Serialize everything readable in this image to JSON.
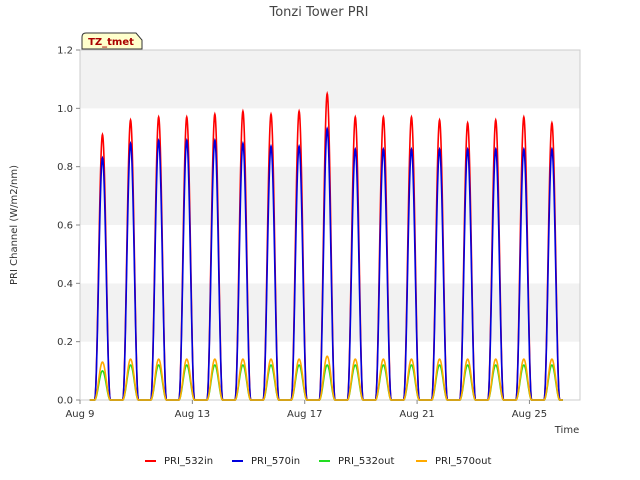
{
  "chart_data": {
    "type": "line",
    "title": "Tonzi Tower PRI",
    "xlabel": "Time",
    "ylabel": "PRI Channel (W/m2/nm)",
    "ylim": [
      0.0,
      1.2
    ],
    "yticks": [
      "0.0",
      "0.2",
      "0.4",
      "0.6",
      "0.8",
      "1.0",
      "1.2"
    ],
    "xlim_days": [
      9,
      26.8
    ],
    "xticks": [
      {
        "day": 9,
        "label": "Aug 9"
      },
      {
        "day": 13,
        "label": "Aug 13"
      },
      {
        "day": 17,
        "label": "Aug 17"
      },
      {
        "day": 21,
        "label": "Aug 21"
      },
      {
        "day": 25,
        "label": "Aug 25"
      }
    ],
    "grid": "horizontal bands",
    "legend_position": "bottom",
    "tag": "TZ_tmet",
    "peak_days": [
      9.8,
      10.8,
      11.8,
      12.8,
      13.8,
      14.8,
      15.8,
      16.8,
      17.8,
      18.8,
      19.8,
      20.8,
      21.8,
      22.8,
      23.8,
      24.8,
      25.8
    ],
    "series": [
      {
        "name": "PRI_532in",
        "color": "#ff0000",
        "peaks": [
          0.91,
          0.96,
          0.97,
          0.97,
          0.98,
          0.99,
          0.98,
          0.99,
          1.05,
          0.97,
          0.97,
          0.97,
          0.96,
          0.95,
          0.96,
          0.97,
          0.95
        ]
      },
      {
        "name": "PRI_570in",
        "color": "#0000dd",
        "peaks": [
          0.83,
          0.88,
          0.89,
          0.89,
          0.89,
          0.88,
          0.87,
          0.87,
          0.93,
          0.86,
          0.86,
          0.86,
          0.86,
          0.86,
          0.86,
          0.86,
          0.86
        ]
      },
      {
        "name": "PRI_532out",
        "color": "#22dd22",
        "peaks": [
          0.1,
          0.12,
          0.12,
          0.12,
          0.12,
          0.12,
          0.12,
          0.12,
          0.12,
          0.12,
          0.12,
          0.12,
          0.12,
          0.12,
          0.12,
          0.12,
          0.12
        ]
      },
      {
        "name": "PRI_570out",
        "color": "#ffaa00",
        "peaks": [
          0.13,
          0.14,
          0.14,
          0.14,
          0.14,
          0.14,
          0.14,
          0.14,
          0.15,
          0.14,
          0.14,
          0.14,
          0.14,
          0.14,
          0.14,
          0.14,
          0.14
        ]
      }
    ]
  }
}
